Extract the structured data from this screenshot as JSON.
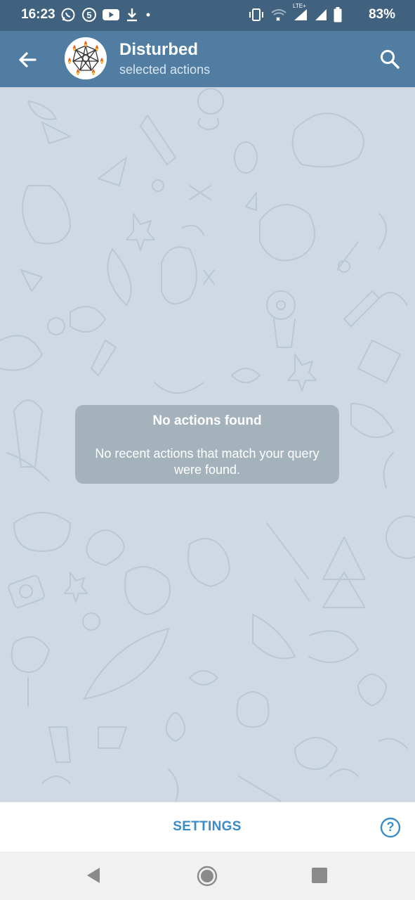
{
  "status_bar": {
    "time": "16:23",
    "left_icons": [
      "whatsapp-icon",
      "5-circle-icon",
      "youtube-icon",
      "download-icon",
      "dot-icon"
    ],
    "right_icons": [
      "vibrate-icon",
      "wifi-off-icon",
      "lte-signal-icon",
      "signal-icon",
      "battery-icon"
    ],
    "lte_label": "LTE+",
    "battery": "83%"
  },
  "header": {
    "title": "Disturbed",
    "subtitle": "selected actions"
  },
  "empty_state": {
    "title": "No actions found",
    "description": "No recent actions that match your query were found."
  },
  "bottom": {
    "settings_label": "SETTINGS",
    "help_label": "?"
  },
  "colors": {
    "status_bar": "#40627f",
    "app_bar": "#517da2",
    "chat_background": "#cfd9e3",
    "accent": "#3a8cc9"
  }
}
